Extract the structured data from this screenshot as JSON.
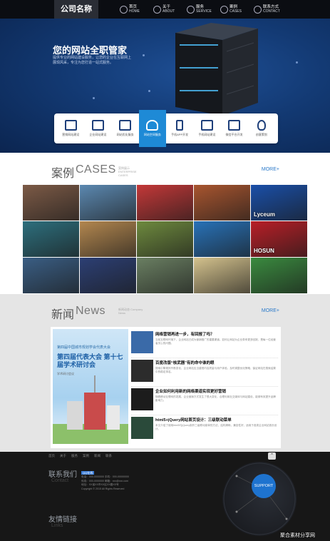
{
  "brand": {
    "logo": "公司名称"
  },
  "nav": [
    {
      "icon": "home-icon",
      "en": "HOME",
      "zh": "首页"
    },
    {
      "icon": "about-icon",
      "en": "ABOUT",
      "zh": "关于"
    },
    {
      "icon": "service-icon",
      "en": "SERVICE",
      "zh": "服务"
    },
    {
      "icon": "case-icon",
      "en": "CASES",
      "zh": "案例"
    },
    {
      "icon": "contact-icon",
      "en": "CONTACT",
      "zh": "联系方式"
    }
  ],
  "hero": {
    "title": "您的网站全职管家",
    "subtitle": "提供专业的网站建设服务，让您的企业在互联网上展现风采，专注为您打造一站式服务。"
  },
  "services": [
    {
      "icon": "monitor-icon",
      "label": "营销网站建设"
    },
    {
      "icon": "screen-icon",
      "label": "企业网站建设"
    },
    {
      "icon": "check-icon",
      "label": "网站优化服务"
    },
    {
      "icon": "cloud-icon",
      "label": "网站空间服务",
      "active": true
    },
    {
      "icon": "phone-icon",
      "label": "手机APP开发"
    },
    {
      "icon": "browser-icon",
      "label": "手机网站建设"
    },
    {
      "icon": "plus-icon",
      "label": "微信平台开发"
    },
    {
      "icon": "bulb-icon",
      "label": "创意策划"
    }
  ],
  "cases": {
    "title_zh": "案例",
    "title_en": "CASES",
    "desc": "案例展示 ENTERPRISE CASES",
    "more": "MORE+",
    "tiles": [
      {
        "color": "#7c5a46"
      },
      {
        "color": "#5b88b0"
      },
      {
        "color": "#c33838"
      },
      {
        "color": "#a8552f"
      },
      {
        "color": "#1a4fa8",
        "caption": "Lyceum"
      },
      {
        "color": "#2d6f7d"
      },
      {
        "color": "#b3874f"
      },
      {
        "color": "#6e8a3e"
      },
      {
        "color": "#2872b8"
      },
      {
        "color": "#b81f27",
        "caption": "HOSUN"
      },
      {
        "color": "#3a5e84"
      },
      {
        "color": "#2c3f74"
      },
      {
        "color": "#6a7f62"
      },
      {
        "color": "#d4c28d"
      },
      {
        "color": "#3a8a3f"
      }
    ]
  },
  "news": {
    "title_zh": "新闻",
    "title_en": "News",
    "desc": "新闻动态 Company News",
    "more": "MORE+",
    "poster": {
      "line1": "第四届中国城市规划学会代表大会",
      "line2": "第四届代表大会 第十七届学术研讨会",
      "line3": "学术研讨会议"
    },
    "items": [
      {
        "title": "网络营销再进一步，有回报了吗？",
        "summary": "当前互联网环境下，企业网站已成为营销推广的重要渠道。如何让网站为企业带来更多回报，是每一位经营者关心的问题。"
      },
      {
        "title": "百度改版“核武器”有的命中谁的眼",
        "summary": "搜索引擎规则不断变化，企业网站应当重视内容质量与用户体验，及时调整优化策略，保证网站在搜索结果中的稳定排名。"
      },
      {
        "title": "企业如何利用新的网络渠道实现更好营销",
        "summary": "随着移动互联网的发展，企业营销方式发生了很大变化，合理利用社交媒体与网站建设，能够有效提升品牌影响力。"
      },
      {
        "title": "html5+jQuery网站首页设计：三级联动菜单",
        "summary": "本文介绍了使用html5与jQuery制作三级联动菜单的方法，结构清晰，兼容性好，适用于各类企业网站首页设计。"
      }
    ]
  },
  "footer": {
    "links": [
      "首页",
      "关于",
      "服务",
      "案例",
      "新闻",
      "联系"
    ],
    "contact_zh": "联系我们",
    "contact_en": "Contact",
    "qq_label": "QQ在线",
    "contact_lines": [
      "电话：000-0000000  手机：000-00000000",
      "传真：000-0000000  邮箱：xxx@xxx.com",
      "地址：XX省XX市XX区XX路XX号",
      "Copyright © 2015 All Rights Reserved"
    ],
    "links_zh": "友情链接",
    "links_en": "Links",
    "badge": "SUPPORT",
    "watermark": "聚合素材分享网"
  },
  "colors": {
    "accent": "#1e8ad6",
    "nav_bg": "#0b0d12",
    "footer_bg": "#171717"
  }
}
